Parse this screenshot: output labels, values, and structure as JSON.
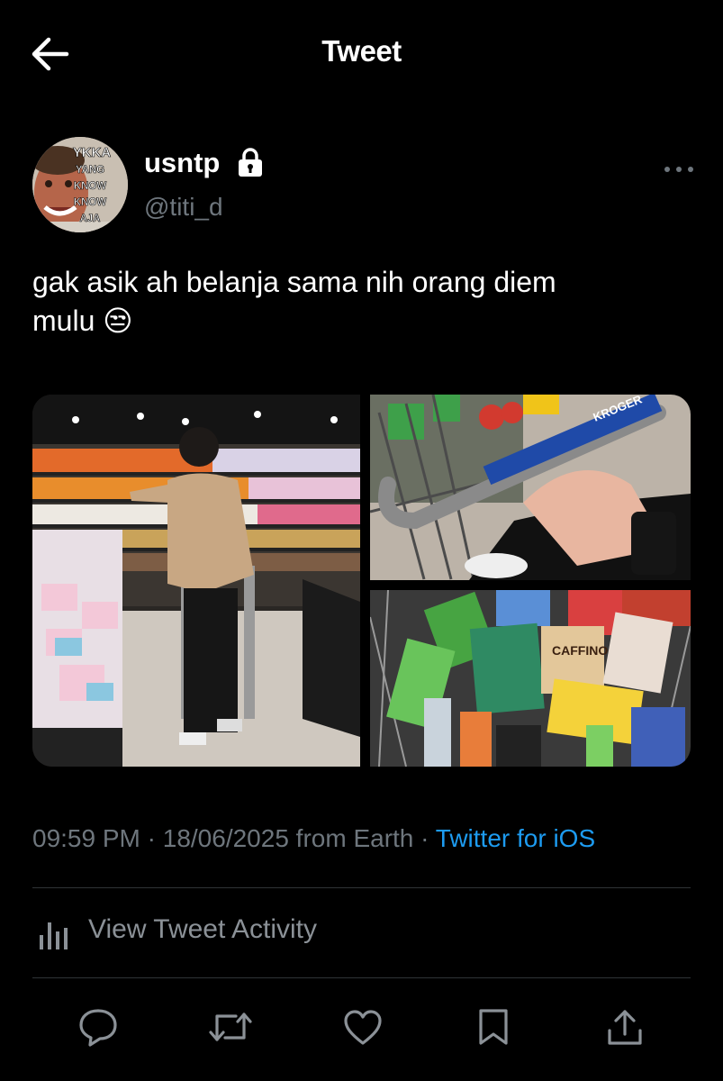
{
  "header": {
    "title": "Tweet",
    "back_icon": "arrow-left-icon"
  },
  "tweet": {
    "author": {
      "display_name": "usntp",
      "handle": "@titi_d",
      "protected": true,
      "avatar_lines": [
        "YKKA",
        "YANG",
        "KNOW",
        "KNOW",
        "AJA"
      ]
    },
    "text_line1": "gak asik ah belanja sama nih orang diem",
    "text_line2": "mulu 😒",
    "media": [
      {
        "description": "grocery-aisle-photo"
      },
      {
        "description": "shopping-cart-handle-photo",
        "label": "KROGER"
      },
      {
        "description": "cart-full-of-snacks-photo",
        "label": "CAFFINO"
      }
    ],
    "time": "09:59 PM",
    "date": "18/06/2025",
    "location": "from Earth",
    "client": "Twitter for iOS",
    "separator": "·"
  },
  "activity": {
    "label": "View Tweet Activity"
  },
  "actions": [
    "reply-icon",
    "retweet-icon",
    "like-icon",
    "bookmark-icon",
    "share-icon"
  ],
  "colors": {
    "background": "#000000",
    "accent": "#1d9bf0",
    "secondary": "#6e767d",
    "divider": "#2f3336"
  }
}
